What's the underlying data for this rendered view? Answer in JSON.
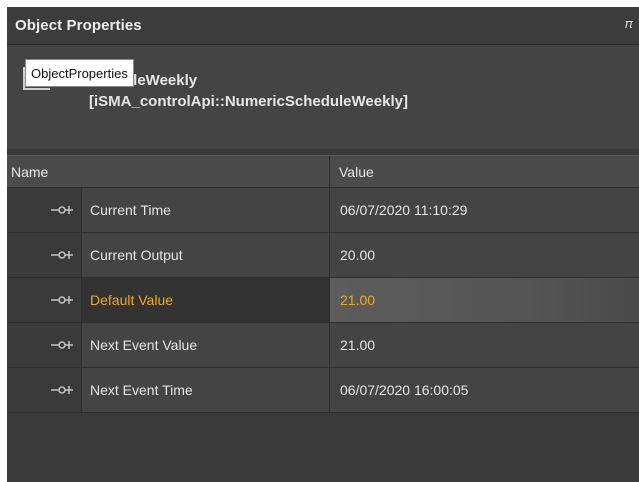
{
  "panel": {
    "title": "Object Properties",
    "pin_icon": "pin-icon"
  },
  "tooltip": {
    "text": "ObjectProperties"
  },
  "object": {
    "name": "cheduleWeekly",
    "type": "[iSMA_controlApi::NumericScheduleWeekly]",
    "icon": "schedule-object-icon"
  },
  "table": {
    "columns": [
      "Name",
      "Value"
    ],
    "rows": [
      {
        "name": "Current Time",
        "value": "06/07/2020 11:10:29",
        "selected": false
      },
      {
        "name": "Current Output",
        "value": "20.00",
        "selected": false
      },
      {
        "name": "Default Value",
        "value": "21.00",
        "selected": true
      },
      {
        "name": "Next Event Value",
        "value": "21.00",
        "selected": false
      },
      {
        "name": "Next Event Time",
        "value": "06/07/2020 16:00:05",
        "selected": false
      }
    ]
  },
  "colors": {
    "panel_bg": "#3a3a3a",
    "cell_bg": "#444444",
    "selected_text": "#f2a81d",
    "text": "#e4e4e4"
  }
}
